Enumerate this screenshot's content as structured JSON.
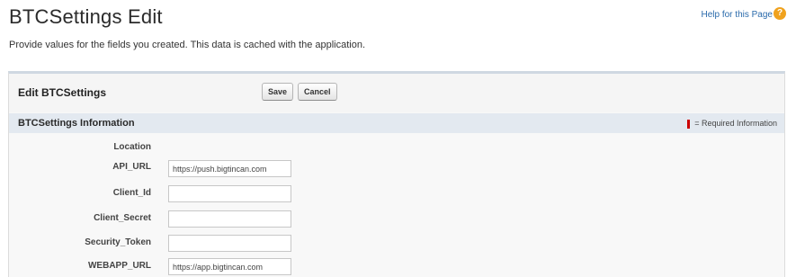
{
  "page": {
    "title": "BTCSettings Edit",
    "help_link": "Help for this Page",
    "help_icon": "?",
    "intro": "Provide values for the fields you created. This data is cached with the application."
  },
  "panel": {
    "title": "Edit BTCSettings",
    "save_label": "Save",
    "cancel_label": "Cancel"
  },
  "section": {
    "title": "BTCSettings Information",
    "required_legend": "= Required Information"
  },
  "fields": [
    {
      "label": "Location",
      "value": ""
    },
    {
      "label": "API_URL",
      "value": "https://push.bigtincan.com"
    },
    {
      "label": "Client_Id",
      "value": ""
    },
    {
      "label": "Client_Secret",
      "value": ""
    },
    {
      "label": "Security_Token",
      "value": ""
    },
    {
      "label": "WEBAPP_URL",
      "value": "https://app.bigtincan.com"
    }
  ],
  "colors": {
    "link": "#2a6aab",
    "help_icon": "#f0a21e",
    "required": "#cc0000",
    "section_bar": "#e3e9f0"
  }
}
